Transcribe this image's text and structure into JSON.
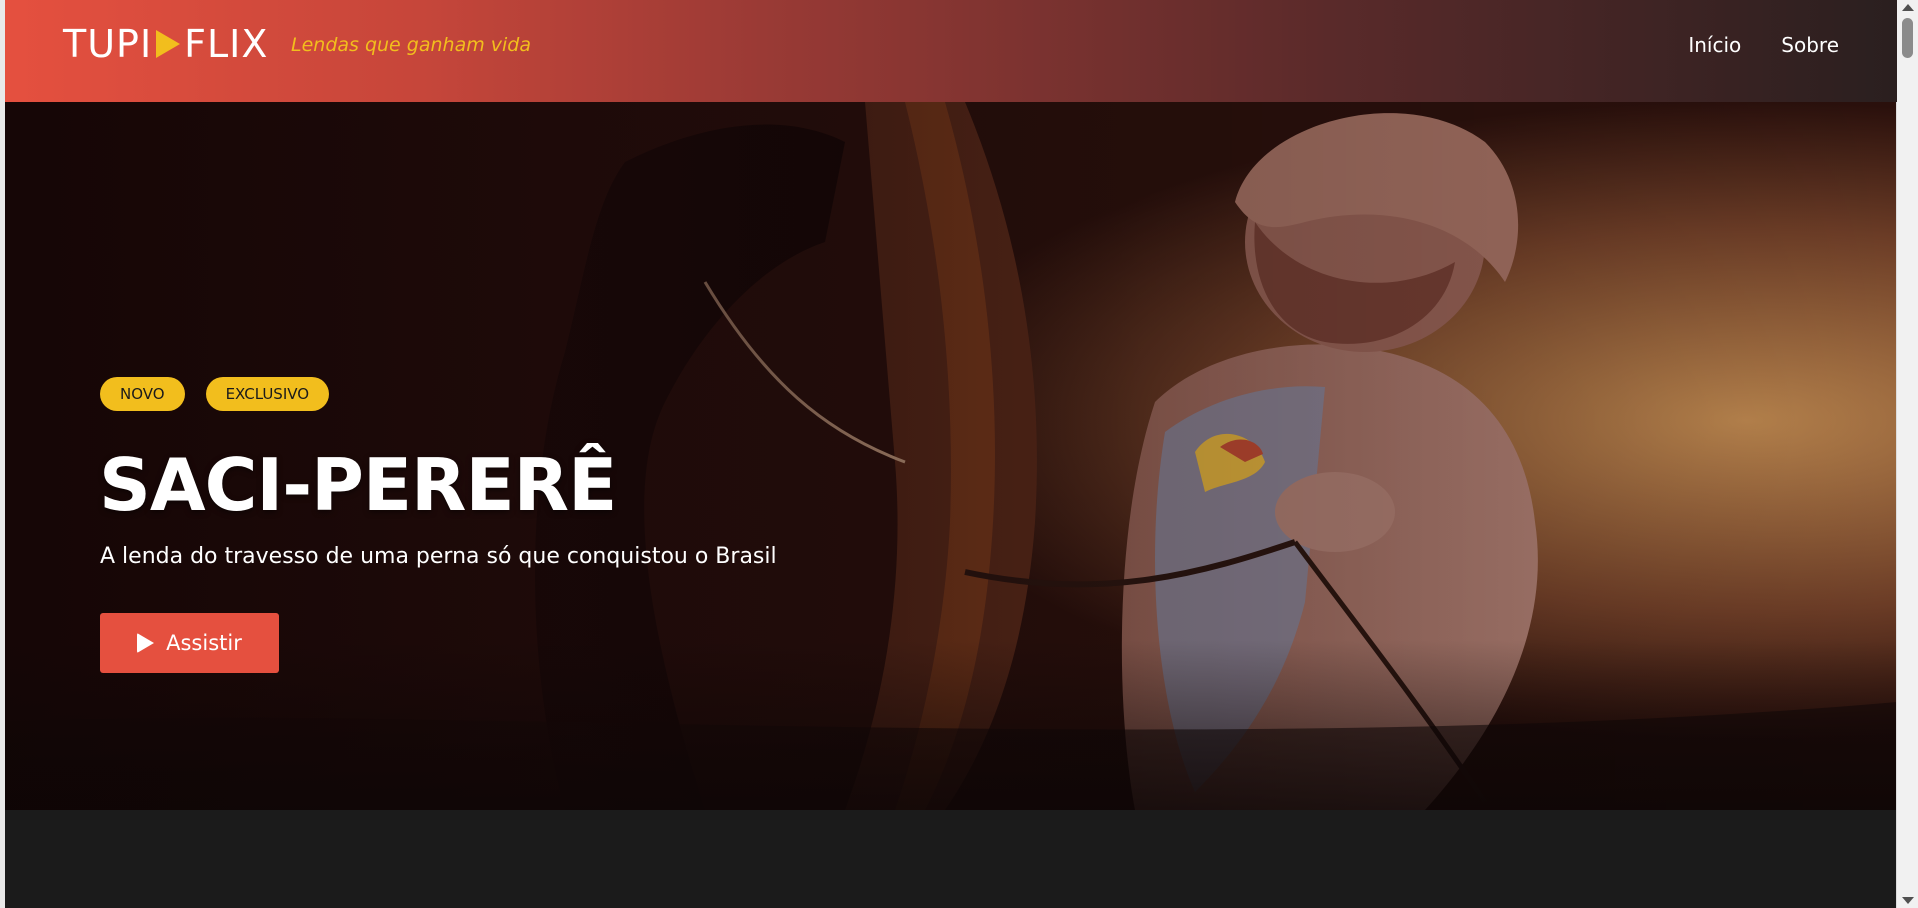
{
  "header": {
    "logo": {
      "part1": "TUPI",
      "part2": "FLIX",
      "play_color": "#f2be1d"
    },
    "tagline": "Lendas que ganham vida",
    "nav": [
      {
        "label": "Início"
      },
      {
        "label": "Sobre"
      }
    ]
  },
  "hero": {
    "badges": [
      "NOVO",
      "EXCLUSIVO"
    ],
    "title": "SACI-PERERÊ",
    "subtitle": "A lenda do travesso de uma perna só que conquistou o Brasil",
    "watch_label": "Assistir",
    "background_image": "animated-horse-rider-scene"
  },
  "colors": {
    "accent": "#e5503f",
    "badge": "#f2be1d",
    "page_background": "#1b1b1b"
  }
}
